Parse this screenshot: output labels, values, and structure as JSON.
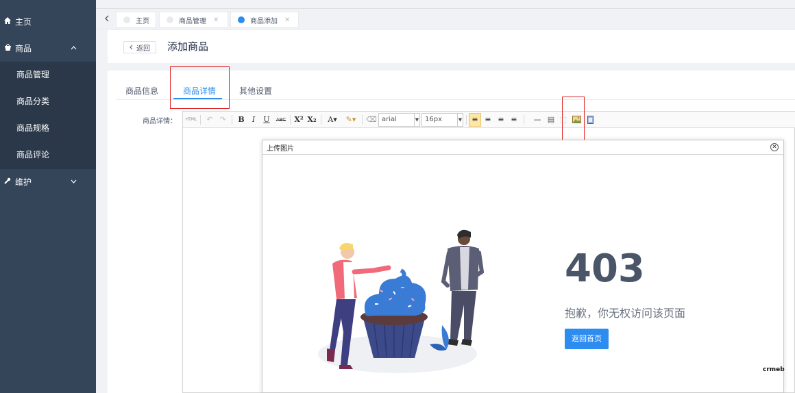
{
  "sidebar": {
    "items": [
      {
        "label": "主页",
        "icon": "home-icon"
      },
      {
        "label": "商品",
        "icon": "goods-icon",
        "expanded": true
      },
      {
        "label": "维护",
        "icon": "wrench-icon",
        "expanded": false
      }
    ],
    "submenu": [
      "商品管理",
      "商品分类",
      "商品规格",
      "商品评论"
    ]
  },
  "tabs": [
    {
      "label": "主页",
      "closable": false,
      "active": false
    },
    {
      "label": "商品管理",
      "closable": true,
      "active": false
    },
    {
      "label": "商品添加",
      "closable": true,
      "active": true
    }
  ],
  "header": {
    "back_label": "返回",
    "title": "添加商品"
  },
  "page_tabs": [
    "商品信息",
    "商品详情",
    "其他设置"
  ],
  "form": {
    "detail_label": "商品详情："
  },
  "toolbar": {
    "html_label": "HTML",
    "font_family": "arial",
    "font_size": "16px"
  },
  "dialog": {
    "title": "上传图片",
    "error_code": "403",
    "error_message": "抱歉，你无权访问该页面",
    "home_button": "返回首页",
    "brand": "crmeb"
  },
  "colors": {
    "sidebar": "#344459",
    "accent": "#2d8cf0",
    "highlight_box": "#e02020"
  }
}
